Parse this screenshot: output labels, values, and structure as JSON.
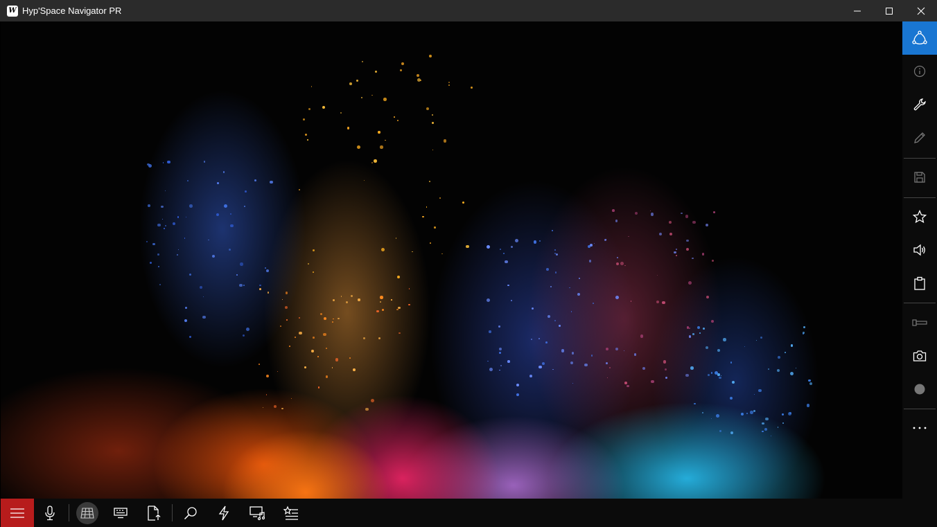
{
  "window": {
    "title": "Hyp'Space Navigator PR",
    "app_icon_letter": "W",
    "controls": [
      "minimize-icon",
      "maximize-icon",
      "close-icon"
    ]
  },
  "right_toolbar": {
    "items": [
      {
        "name": "share-nodes-icon",
        "active": true
      },
      {
        "name": "info-icon"
      },
      {
        "name": "wrench-icon"
      },
      {
        "name": "pencil-icon"
      },
      {
        "name": "save-icon"
      },
      {
        "name": "star-icon"
      },
      {
        "name": "volume-icon"
      },
      {
        "name": "clipboard-icon"
      },
      {
        "name": "connector-icon"
      },
      {
        "name": "camera-icon"
      },
      {
        "name": "record-icon"
      },
      {
        "name": "more-icon"
      }
    ],
    "accent_color": "#1976d2"
  },
  "bottom_toolbar": {
    "items": [
      {
        "name": "hamburger-menu-icon",
        "accent": "#b71c1c"
      },
      {
        "name": "microphone-icon"
      },
      {
        "name": "grid-icon",
        "selected": true
      },
      {
        "name": "keyboard-icon"
      },
      {
        "name": "export-file-icon"
      },
      {
        "name": "search-icon"
      },
      {
        "name": "lightning-icon"
      },
      {
        "name": "devices-music-icon"
      },
      {
        "name": "favorites-list-icon"
      }
    ]
  },
  "content": {
    "image": "colorful powder explosion wallpaper"
  }
}
